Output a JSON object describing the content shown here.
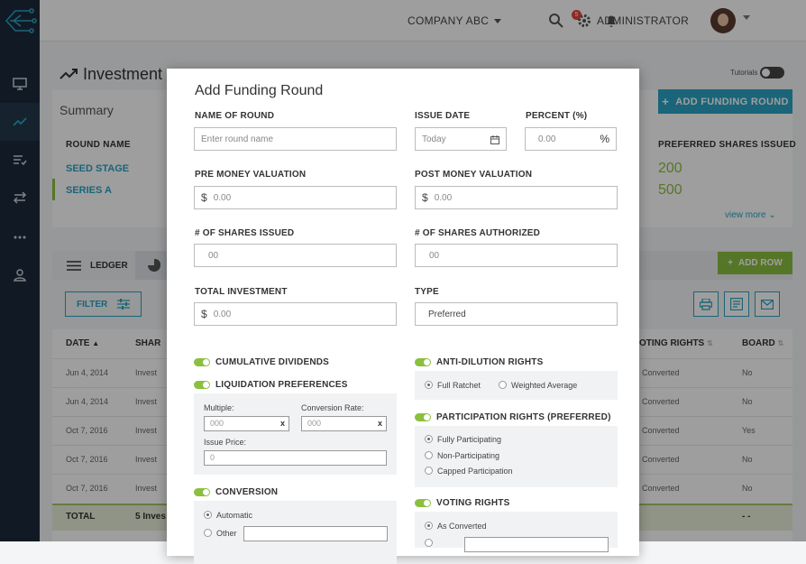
{
  "topbar": {
    "company": "COMPANY ABC",
    "notifications": "5",
    "user": "ADMINISTRATOR"
  },
  "page": {
    "title": "Investment",
    "tutorials": "Tutorials",
    "add_round": "ADD FUNDING ROUND",
    "summary": "Summary"
  },
  "summary": {
    "col_round": "ROUND NAME",
    "col_pref": "PREFERRED SHARES ISSUED",
    "rows": [
      {
        "name": "SEED STAGE",
        "pref": "200"
      },
      {
        "name": "SERIES A",
        "pref": "500"
      }
    ],
    "view_more": "view more"
  },
  "ledger": {
    "tab": "LEDGER",
    "add_row": "ADD ROW",
    "filter": "FILTER",
    "headers": {
      "date": "DATE",
      "share": "SHAR",
      "voting": "OTING RIGHTS",
      "board": "BOARD"
    },
    "rows": [
      {
        "date": "Jun 4, 2014",
        "holder": "Invest",
        "voting": "Converted",
        "board": "No"
      },
      {
        "date": "Jun 4, 2014",
        "holder": "Invest",
        "voting": "Converted",
        "board": "No"
      },
      {
        "date": "Oct 7, 2016",
        "holder": "Invest",
        "voting": "Converted",
        "board": "Yes"
      },
      {
        "date": "Oct 7, 2016",
        "holder": "Invest",
        "voting": "Converted",
        "board": "No"
      },
      {
        "date": "Oct 7, 2016",
        "holder": "Invest",
        "voting": "Converted",
        "board": "No"
      }
    ],
    "total_label": "TOTAL",
    "total_holder": "5 Inves",
    "total_board": "- -"
  },
  "modal": {
    "title": "Add Funding Round",
    "name_label": "NAME OF ROUND",
    "name_placeholder": "Enter round name",
    "date_label": "ISSUE DATE",
    "date_placeholder": "Today",
    "percent_label": "PERCENT (%)",
    "percent_placeholder": "0.00",
    "percent_sign": "%",
    "pre_label": "PRE MONEY VALUATION",
    "pre_value": "0.00",
    "post_label": "POST MONEY VALUATION",
    "post_value": "0.00",
    "shares_issued_label": "# OF SHARES ISSUED",
    "shares_issued_value": "00",
    "shares_auth_label": "# OF SHARES AUTHORIZED",
    "shares_auth_value": "00",
    "total_label": "TOTAL INVESTMENT",
    "total_value": "0.00",
    "type_label": "TYPE",
    "type_value": "Preferred",
    "currency": "$",
    "cumulative": "CUMULATIVE DIVIDENDS",
    "liquidation": "LIQUIDATION PREFERENCES",
    "multiple_label": "Multiple:",
    "multiple_value": "000",
    "conv_rate_label": "Conversion Rate:",
    "conv_rate_value": "000",
    "issue_price_label": "Issue Price:",
    "issue_price_value": "0",
    "clear": "x",
    "conversion": "CONVERSION",
    "automatic": "Automatic",
    "other": "Other",
    "anti_dilution": "ANTI-DILUTION RIGHTS",
    "full_ratchet": "Full Ratchet",
    "weighted": "Weighted Average",
    "participation": "PARTICIPATION RIGHTS (PREFERRED)",
    "fully": "Fully Participating",
    "non": "Non-Participating",
    "capped": "Capped Participation",
    "voting": "VOTING RIGHTS",
    "as_converted": "As Converted"
  }
}
